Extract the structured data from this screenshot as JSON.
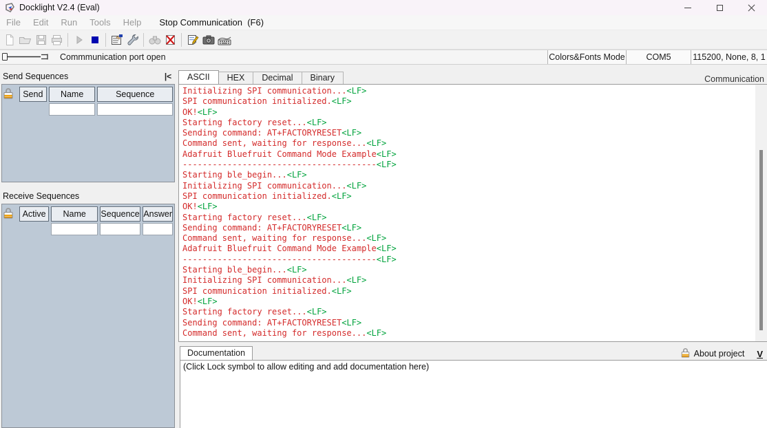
{
  "window": {
    "title": "Docklight V2.4 (Eval)",
    "controls": [
      "minimize-icon",
      "maximize-icon",
      "close-icon"
    ],
    "app_icon": "docklight-logo-icon"
  },
  "menu": {
    "items": [
      {
        "label": "File",
        "enabled": false
      },
      {
        "label": "Edit",
        "enabled": false
      },
      {
        "label": "Run",
        "enabled": false
      },
      {
        "label": "Tools",
        "enabled": false
      },
      {
        "label": "Help",
        "enabled": false
      },
      {
        "label": "Stop Communication  (F6)",
        "enabled": true
      }
    ]
  },
  "toolbar": {
    "buttons": [
      {
        "icon": "new-project-icon",
        "enabled": false
      },
      {
        "icon": "open-project-icon",
        "enabled": false
      },
      {
        "icon": "save-project-icon",
        "enabled": false
      },
      {
        "icon": "print-icon",
        "enabled": false
      },
      {
        "icon": "start-communication-icon",
        "enabled": false
      },
      {
        "icon": "stop-communication-icon",
        "enabled": true
      },
      {
        "icon": "project-settings-icon",
        "enabled": true
      },
      {
        "icon": "options-wrench-icon",
        "enabled": true
      },
      {
        "icon": "find-binoculars-icon",
        "enabled": false
      },
      {
        "icon": "clear-communication-icon",
        "enabled": true
      },
      {
        "icon": "edit-notes-icon",
        "enabled": true
      },
      {
        "icon": "snapshot-camera-icon",
        "enabled": true
      },
      {
        "icon": "keyboard-console-icon",
        "enabled": true
      }
    ]
  },
  "status": {
    "message": "Commmunication port open",
    "mode": "Colors&Fonts Mode",
    "port": "COM5",
    "port_settings": "115200, None, 8, 1"
  },
  "send_sequences": {
    "title": "Send Sequences",
    "collapse_button": "|<",
    "columns": [
      "Send",
      "Name",
      "Sequence"
    ]
  },
  "receive_sequences": {
    "title": "Receive Sequences",
    "columns": [
      "Active",
      "Name",
      "Sequence",
      "Answer"
    ]
  },
  "communication": {
    "window_label": "Communication",
    "tabs": [
      "ASCII",
      "HEX",
      "Decimal",
      "Binary"
    ],
    "active_tab": "ASCII",
    "lf_token": "<LF>",
    "lines": [
      "Initializing SPI communication...",
      "SPI communication initialized.",
      "OK!",
      "Starting factory reset...",
      "Sending command: AT+FACTORYRESET",
      "Command sent, waiting for response...",
      "Adafruit Bluefruit Command Mode Example",
      "---------------------------------------",
      "Starting ble_begin...",
      "Initializing SPI communication...",
      "SPI communication initialized.",
      "OK!",
      "Starting factory reset...",
      "Sending command: AT+FACTORYRESET",
      "Command sent, waiting for response...",
      "Adafruit Bluefruit Command Mode Example",
      "---------------------------------------",
      "Starting ble_begin...",
      "Initializing SPI communication...",
      "SPI communication initialized.",
      "OK!",
      "Starting factory reset...",
      "Sending command: AT+FACTORYRESET",
      "Command sent, waiting for response..."
    ]
  },
  "documentation": {
    "tab_label": "Documentation",
    "content": "(Click Lock symbol to allow editing and add documentation here)",
    "about_label": "About project",
    "view_shortcut": "V"
  },
  "colors": {
    "rx_text": "#d42b2b",
    "lf_token": "#00a33c",
    "panel_bg": "#bdc9d6",
    "stop_button": "#0008b0",
    "lock_body": "#f0a30a"
  }
}
